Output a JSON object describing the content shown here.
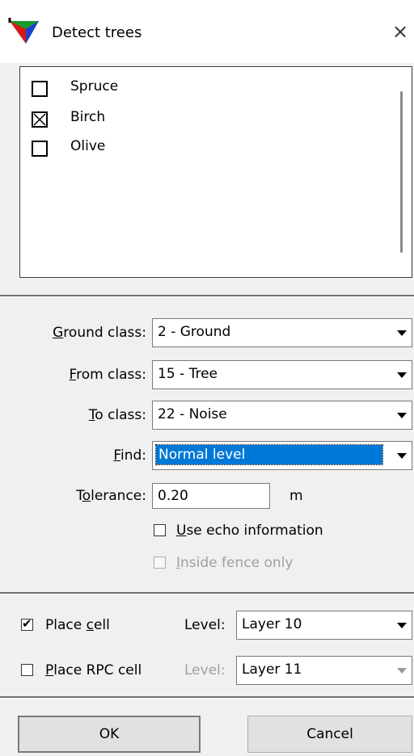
{
  "window": {
    "title": "Detect trees",
    "close_glyph": "×",
    "icon": "triangle-color-icon"
  },
  "tree_list": {
    "items": [
      {
        "label": "Spruce",
        "checked": false
      },
      {
        "label": "Birch",
        "checked": true
      },
      {
        "label": "Olive",
        "checked": false
      }
    ],
    "check_glyph": "✕"
  },
  "fields": {
    "ground_class": {
      "hot": "G",
      "rest": "round class:",
      "value": "2 - Ground"
    },
    "from_class": {
      "hot": "F",
      "rest": "rom class:",
      "value": "15 - Tree"
    },
    "to_class": {
      "hot": "T",
      "rest": "o class:",
      "value": "22 - Noise"
    },
    "find": {
      "hot": "F",
      "rest": "ind:",
      "value": "Normal level"
    },
    "tolerance": {
      "pre": "T",
      "hot": "o",
      "rest": "lerance:",
      "value": "0.20",
      "unit": "m"
    }
  },
  "options": {
    "use_echo": {
      "hot": "U",
      "rest": "se echo information",
      "checked": false
    },
    "inside_fence": {
      "hot": "I",
      "rest": "nside fence only",
      "checked": false,
      "disabled": true
    }
  },
  "cells": {
    "place_cell": {
      "pre": "Place ",
      "hot": "c",
      "rest": "ell",
      "checked": true,
      "level_label": "Level:",
      "level_value": "Layer 10"
    },
    "place_rpc": {
      "hot": "P",
      "rest": "lace RPC cell",
      "checked": false,
      "level_label": "Level:",
      "level_value": "Layer 11"
    }
  },
  "check_mark": "✔",
  "buttons": {
    "ok": "OK",
    "cancel": "Cancel"
  },
  "colors": {
    "selection": "#0078d7",
    "background": "#f0f0f0"
  }
}
